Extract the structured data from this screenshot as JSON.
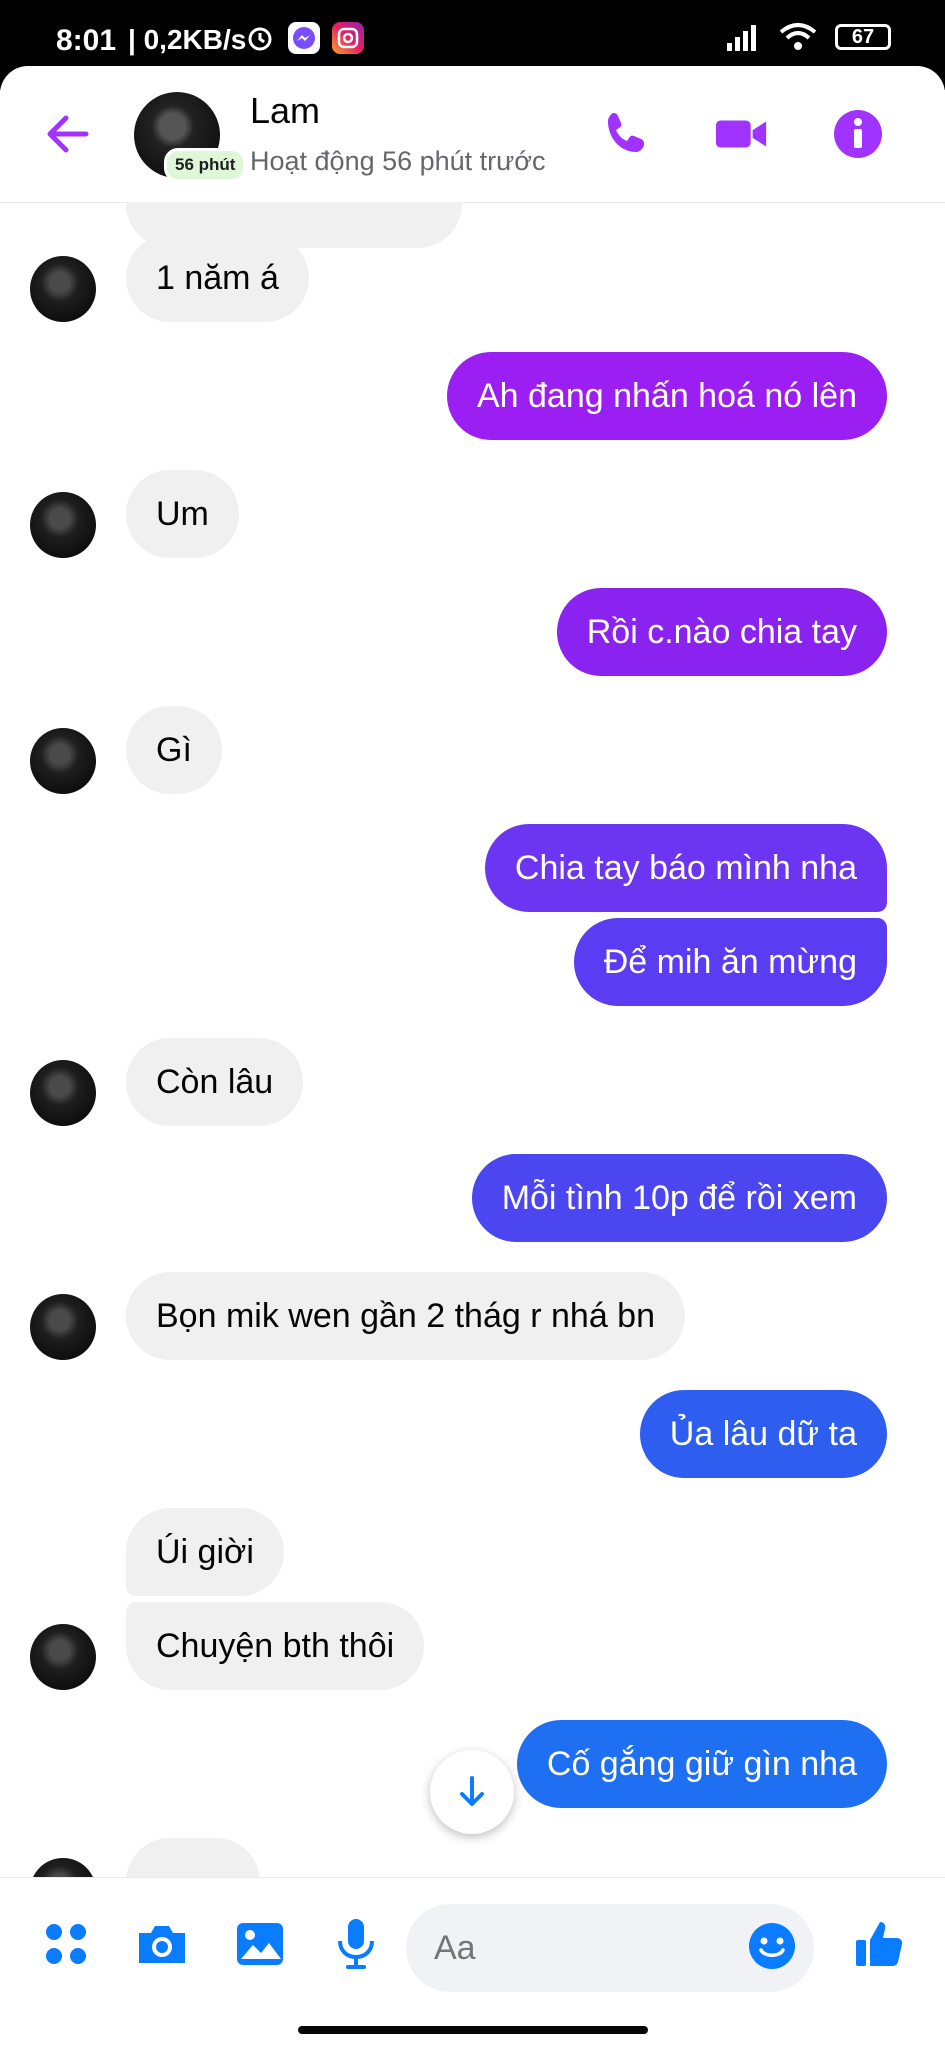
{
  "status_bar": {
    "time": "8:01",
    "net_speed": "| 0,2KB/s",
    "battery": "67"
  },
  "header": {
    "contact_name": "Lam",
    "active_badge": "56 phút",
    "active_status": "Hoạt động 56 phút trước",
    "accent_color": "#a033ff"
  },
  "messages": [
    {
      "side": "in",
      "text": "1 năm á"
    },
    {
      "side": "out",
      "text": "Ah đang nhấn hoá nó lên",
      "color": "#9b1ff2"
    },
    {
      "side": "in",
      "text": "Um"
    },
    {
      "side": "out",
      "text": "Rồi c.nào chia tay",
      "color": "#8a22f0"
    },
    {
      "side": "in",
      "text": "Gì"
    },
    {
      "side": "out",
      "text": "Chia tay báo mình nha",
      "color": "#6b35f2"
    },
    {
      "side": "out",
      "text": "Để mih ăn mừng",
      "color": "#5a3cf2"
    },
    {
      "side": "in",
      "text": "Còn lâu"
    },
    {
      "side": "out",
      "text": "Mỗi tình 10p để rồi xem",
      "color": "#4b46f0"
    },
    {
      "side": "in",
      "text": "Bọn mik wen gần 2 thág r nhá bn"
    },
    {
      "side": "out",
      "text": "Ủa lâu dữ ta",
      "color": "#2d5ef0"
    },
    {
      "side": "in",
      "text": "Úi giời"
    },
    {
      "side": "in",
      "text": "Chuyện bth thôi"
    },
    {
      "side": "out",
      "text": "Cố gắng giữ gìn nha",
      "color": "#1f6ff2"
    }
  ],
  "composer": {
    "placeholder": "Aa",
    "icon_color": "#0a7cff"
  }
}
